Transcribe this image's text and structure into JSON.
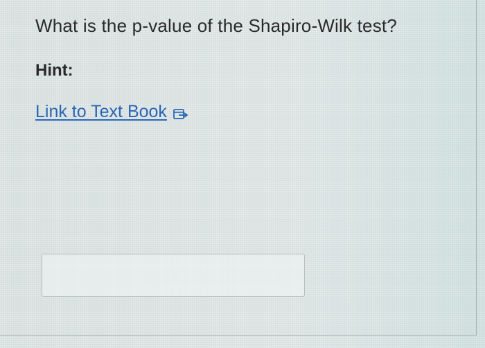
{
  "question": {
    "text": "What is the p-value of the Shapiro-Wilk test?"
  },
  "hint": {
    "label": "Hint:"
  },
  "link": {
    "text": "Link to Text Book",
    "icon": "external-link-icon"
  },
  "answer": {
    "value": "",
    "placeholder": ""
  },
  "colors": {
    "link": "#2a66b5",
    "text": "#2a2a2a",
    "input_border": "#b7bebe"
  }
}
